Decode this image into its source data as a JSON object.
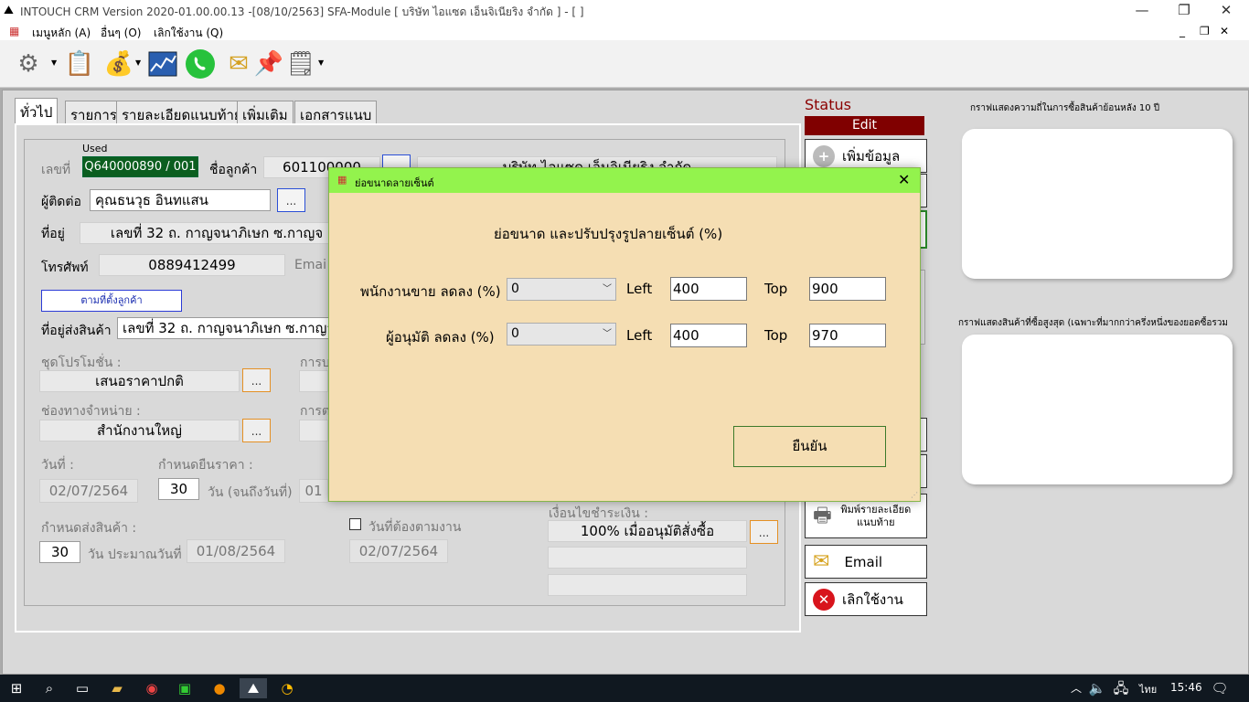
{
  "window": {
    "title": "INTOUCH CRM Version 2020-01.00.00.13 -[08/10/2563] SFA-Module  [ บริษัท ไอแซด เอ็นจิเนียริง จำกัด ] - [ ]",
    "minimize": "—",
    "restore": "❐",
    "close": "✕"
  },
  "menu": {
    "items": [
      "เมนูหลัก (A)",
      "อื่นๆ (O)",
      "เลิกใช้งาน (Q)"
    ],
    "mdi_minimize": "_",
    "mdi_restore": "❐",
    "mdi_close": "✕"
  },
  "toolbar": {
    "icons": [
      "gear-icon",
      "note-icon",
      "money-bag-icon",
      "chart-icon",
      "whatsapp-icon",
      "email-icon",
      "pin-icon",
      "report-icon"
    ]
  },
  "tabs": [
    "ทั่วไป",
    "รายการ",
    "รายละเอียดแนบท้าย",
    "เพิ่มเติม",
    "เอกสารแนบ"
  ],
  "form": {
    "used_label": "Used",
    "doc_no_label": "เลขที่",
    "doc_no": "Q640000890 / 001",
    "customer_label": "ชื่อลูกค้า",
    "customer_code": "601100000",
    "customer_name": "บริษัท ไอแซด เอ็นจิเนียริง จำกัด",
    "contact_label": "ผู้ติดต่อ",
    "contact": "คุณธนวุธ อินทแสน",
    "address_label": "ที่อยู่",
    "address": "เลขที่  32  ถ. กาญจนาภิเษก  ซ.กาญจ",
    "phone_label": "โทรศัพท์",
    "phone": "0889412499",
    "email_label": "Emai",
    "follow_customer_button": "ตามที่ตั้งลูกค้า",
    "ship_address_label": "ที่อยู่ส่งสินค้า",
    "ship_address": "เลขที่  32  ถ. กาญจนาภิเษก  ซ.กาญจ",
    "promo_label": "ชุดโปรโมชั่น :",
    "promo_value": "เสนอราคาปกติ",
    "channel_label": "ช่องทางจำหน่าย  :",
    "channel_value": "สำนักงานใหญ่",
    "hidden_label_1": "การบ",
    "hidden_label_2": "การต",
    "date_label": "วันที่ :",
    "date_value": "02/07/2564",
    "price_valid_label": "กำหนดยืนราคา :",
    "price_valid_days": "30",
    "price_valid_unit": "วัน (จนถึงวันที่)",
    "price_valid_partial": "01",
    "delivery_label": "กำหนดส่งสินค้า :",
    "delivery_days": "30",
    "delivery_unit": "วัน ประมาณวันที่",
    "delivery_date": "01/08/2564",
    "follow_up_label": "วันที่ต้องตามงาน",
    "follow_up_date": "02/07/2564",
    "payment_label": "เงื่อนไขชำระเงิน :",
    "payment_value": "100% เมื่ออนุมัติสั่งซื้อ",
    "dots": "..."
  },
  "status": {
    "title": "Status",
    "badge": "Edit",
    "add_button": "เพิ่มข้อมูล",
    "print_detail_button": "พิมพ์รายละเอียดแนบท้าย",
    "email_button": "Email",
    "exit_button": "เลิกใช้งาน",
    "colors": {
      "badge_bg": "#800000",
      "title": "#8b0000"
    }
  },
  "charts": {
    "history_title": "กราฟแสดงความถี่ในการซื้อสินค้าย้อนหลัง 10 ปี",
    "top_products_title": "กราฟแสดงสินค้าที่ซื้อสูงสุด (เฉพาะที่มากกว่าครึ่งหนึ่งของยอดซื้อรวม"
  },
  "dialog": {
    "title": "ย่อขนาดลายเซ็นต์",
    "close": "✕",
    "heading": "ย่อขนาด และปรับปรุงรูปลายเซ็นต์ (%)",
    "row1_label": "พนักงานขาย ลดลง (%)",
    "row1_combo": "0",
    "row1_left_label": "Left",
    "row1_left": "400",
    "row1_top_label": "Top",
    "row1_top": "900",
    "row2_label": "ผู้อนุมัติ ลดลง (%)",
    "row2_combo": "0",
    "row2_left_label": "Left",
    "row2_left": "400",
    "row2_top_label": "Top",
    "row2_top": "970",
    "confirm_button": "ยืนยัน",
    "colors": {
      "bg": "#f5deb3",
      "titlebar": "#93f34d",
      "button_border": "#3c7a2a"
    }
  },
  "taskbar": {
    "language": "ไทย",
    "time": "15:46"
  }
}
